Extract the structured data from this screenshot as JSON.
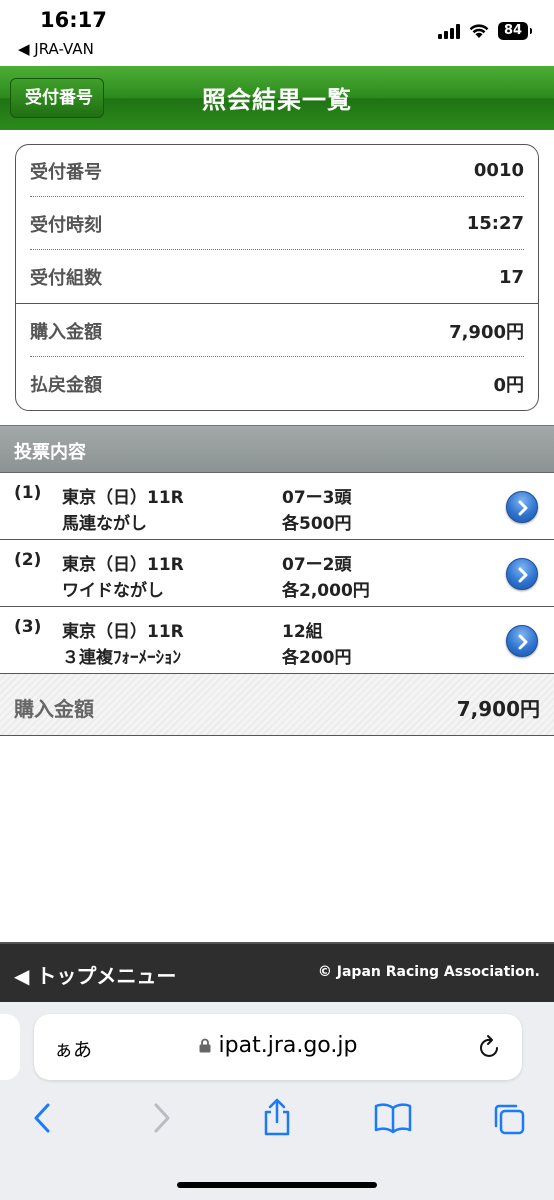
{
  "status_bar": {
    "time": "16:17",
    "back_app": "◀ JRA-VAN",
    "battery": "84"
  },
  "header": {
    "back_label": "受付番号",
    "title": "照会結果一覧"
  },
  "summary": {
    "rows": [
      {
        "label": "受付番号",
        "value": "0010"
      },
      {
        "label": "受付時刻",
        "value": "15:27"
      },
      {
        "label": "受付組数",
        "value": "17"
      },
      {
        "label": "購入金額",
        "value": "7,900円"
      },
      {
        "label": "払戻金額",
        "value": "0円"
      }
    ]
  },
  "section": {
    "title": "投票内容"
  },
  "bets": [
    {
      "num": "(1)",
      "race": "東京（日）11R",
      "type": "馬連ながし",
      "combo": "07ー3頭",
      "amount": "各500円"
    },
    {
      "num": "(2)",
      "race": "東京（日）11R",
      "type": "ワイドながし",
      "combo": "07ー2頭",
      "amount": "各2,000円"
    },
    {
      "num": "(3)",
      "race": "東京（日）11R",
      "type": "３連複ﾌｫｰﾒｰｼｮﾝ",
      "combo": "12組",
      "amount": "各200円"
    }
  ],
  "total": {
    "label": "購入金額",
    "value": "7,900円"
  },
  "footer": {
    "top_menu": "◀ トップメニュー",
    "copyright": "© Japan Racing Association."
  },
  "browser": {
    "aa_label": "ぁあ",
    "url": "ipat.jra.go.jp"
  },
  "icons": {
    "bet_arrow": "chevron-right-circle-icon",
    "toolbar": [
      "back-icon",
      "forward-icon",
      "share-icon",
      "bookmarks-icon",
      "tabs-icon"
    ]
  },
  "colors": {
    "header_green": "#2d8a1e",
    "link_blue": "#2f74d0",
    "footer_dark": "#2e2e2e",
    "safari_blue": "#1a7af8"
  }
}
